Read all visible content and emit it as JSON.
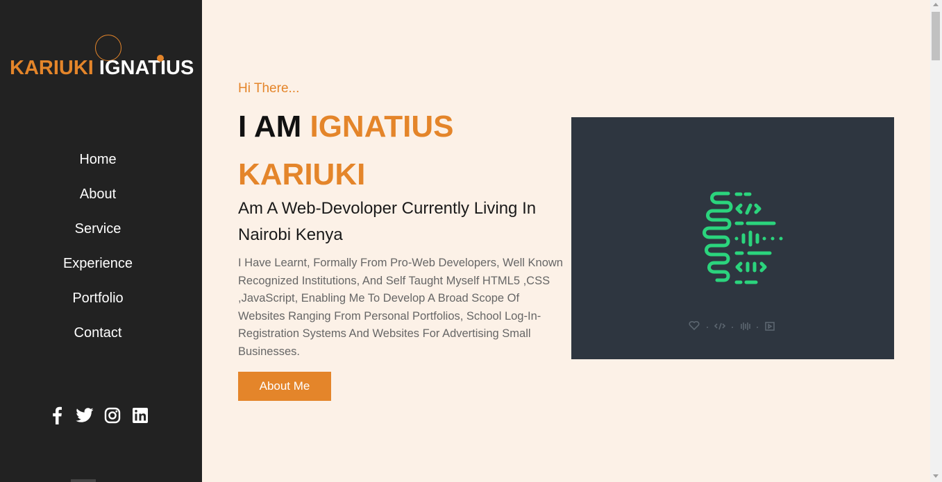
{
  "logo": {
    "first_name": "KARIUKI",
    "last_name": "IGNATIUS"
  },
  "nav": {
    "items": [
      {
        "label": "Home"
      },
      {
        "label": "About"
      },
      {
        "label": "Service"
      },
      {
        "label": "Experience"
      },
      {
        "label": "Portfolio"
      },
      {
        "label": "Contact"
      }
    ]
  },
  "socials": [
    "facebook-icon",
    "twitter-icon",
    "instagram-icon",
    "linkedin-icon"
  ],
  "hero": {
    "greeting": "Hi There...",
    "heading_prefix": "I AM",
    "heading_name": "IGNATIUS KARIUKI",
    "subheading": "Am A Web-Devoloper Currently Living In Nairobi Kenya",
    "paragraph": "I Have Learnt, Formally From Pro-Web Developers, Well Known Recognized Institutions, And Self Taught Myself HTML5 ,CSS ,JavaScript, Enabling Me To Develop A Broad Scope Of Websites Ranging From Personal Portfolios, School Log-In-Registration Systems And Websites For Advertising Small Businesses.",
    "button_label": "About Me"
  },
  "colors": {
    "accent": "#e4852a",
    "sidebar_bg": "#222222",
    "page_bg": "#fcf1e7",
    "image_bg": "#2e3640",
    "logo_green": "#2bd47d"
  }
}
